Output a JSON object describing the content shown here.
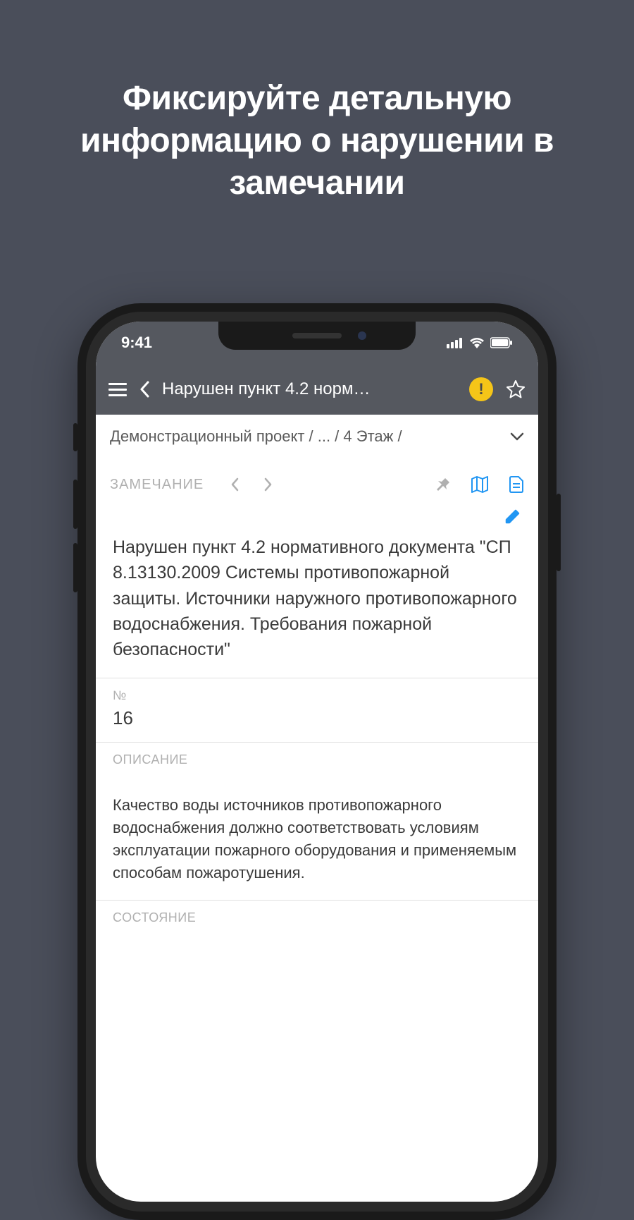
{
  "promo": {
    "headline": "Фиксируйте детальную информацию о нарушении в замечании"
  },
  "status": {
    "time": "9:41"
  },
  "nav": {
    "title": "Нарушен пункт 4.2 норм…"
  },
  "breadcrumb": {
    "text": "Демонстрационный проект / ... / 4 Этаж /"
  },
  "tabs": {
    "label": "ЗАМЕЧАНИЕ"
  },
  "detail": {
    "title": "Нарушен пункт 4.2 нормативного документа \"СП 8.13130.2009 Системы противопожарной защиты. Источники наружного противопожарного водоснабжения. Требования пожарной безопасности\"",
    "number_label": "№",
    "number_value": "16",
    "description_label": "ОПИСАНИЕ",
    "description_text": "Качество воды источников противопожарного водоснабжения должно соответствовать условиям эксплуатации пожарного оборудования и применяемым способам пожаротушения.",
    "state_label": "СОСТОЯНИЕ"
  },
  "colors": {
    "background": "#4a4e5a",
    "navbar": "#55585f",
    "accent": "#2196f3",
    "warn": "#f5c518"
  }
}
